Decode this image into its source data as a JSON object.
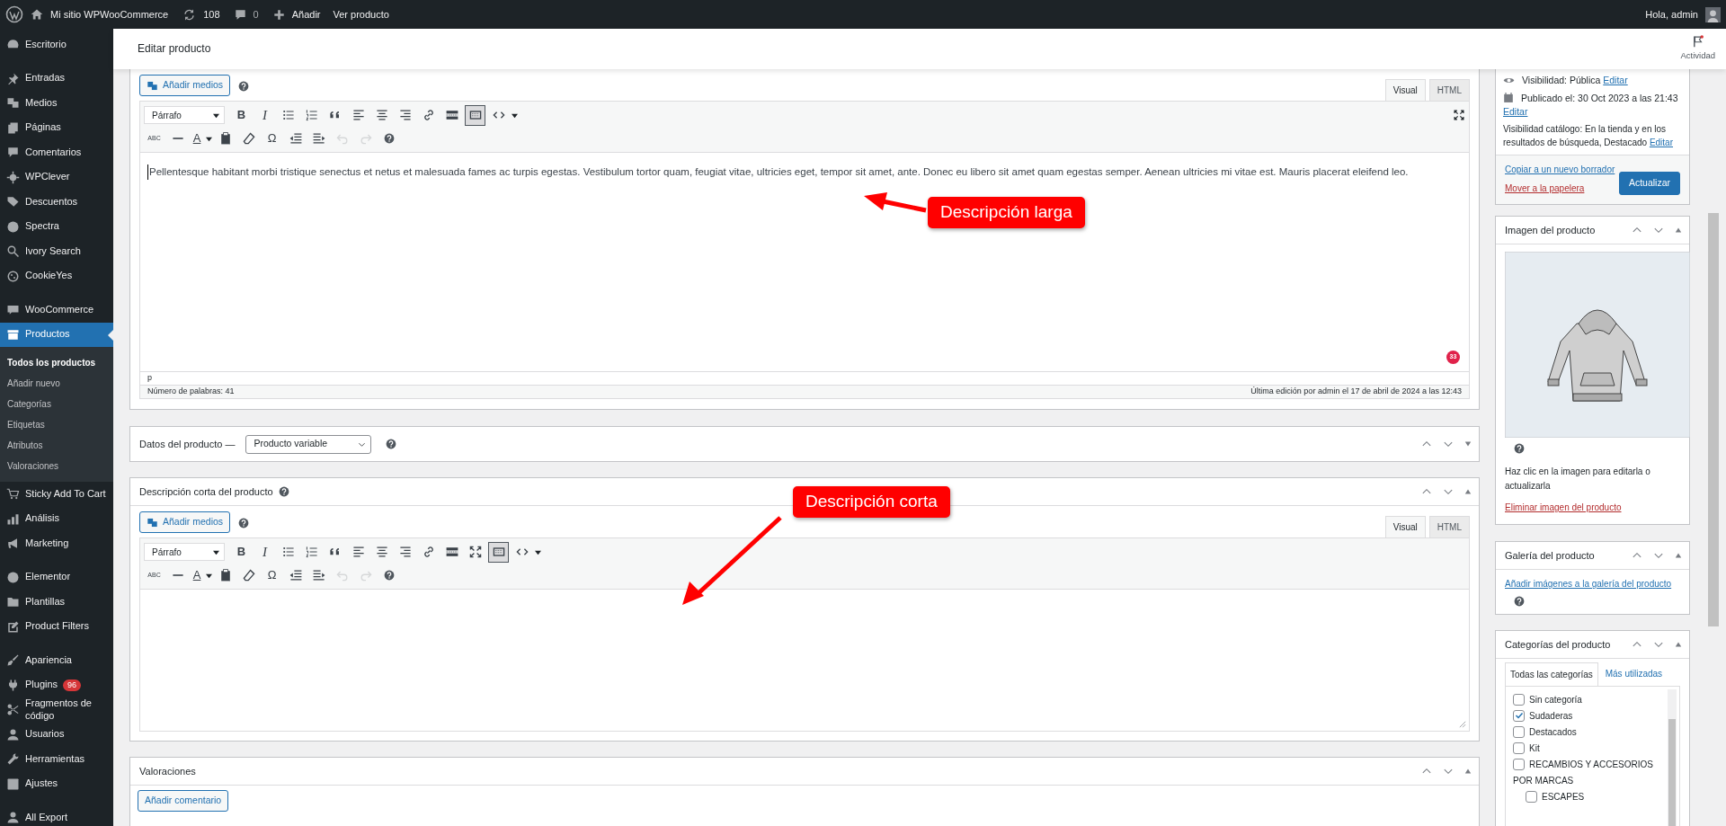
{
  "admin_bar": {
    "site": "Mi sitio WPWooCommerce",
    "updates": "108",
    "comments": "0",
    "new": "Añadir",
    "view": "Ver producto",
    "greeting": "Hola, admin"
  },
  "sidebar": {
    "groups": [
      [
        {
          "label": "Escritorio",
          "selected": false
        }
      ],
      [
        {
          "label": "Entradas",
          "selected": false
        },
        {
          "label": "Medios",
          "selected": false
        },
        {
          "label": "Páginas",
          "selected": false
        },
        {
          "label": "Comentarios",
          "selected": false
        },
        {
          "label": "WPClever",
          "selected": false
        },
        {
          "label": "Descuentos",
          "selected": false
        },
        {
          "label": "Spectra",
          "selected": false
        },
        {
          "label": "Ivory Search",
          "selected": false
        },
        {
          "label": "CookieYes",
          "selected": false
        }
      ],
      [
        {
          "label": "WooCommerce",
          "selected": false
        },
        {
          "label": "Productos",
          "selected": true,
          "children": [
            {
              "label": "Todos los productos",
              "selected": true
            },
            {
              "label": "Añadir nuevo",
              "selected": false
            },
            {
              "label": "Categorías",
              "selected": false
            },
            {
              "label": "Etiquetas",
              "selected": false
            },
            {
              "label": "Atributos",
              "selected": false
            },
            {
              "label": "Valoraciones",
              "selected": false
            }
          ]
        },
        {
          "label": "Sticky Add To Cart",
          "selected": false
        },
        {
          "label": "Análisis",
          "selected": false
        },
        {
          "label": "Marketing",
          "selected": false
        }
      ],
      [
        {
          "label": "Elementor",
          "selected": false
        },
        {
          "label": "Plantillas",
          "selected": false
        },
        {
          "label": "Product Filters",
          "selected": false
        }
      ],
      [
        {
          "label": "Apariencia",
          "selected": false
        },
        {
          "label": "Plugins",
          "selected": false,
          "badge": "96"
        },
        {
          "label": "Fragmentos de código",
          "selected": false
        },
        {
          "label": "Usuarios",
          "selected": false
        },
        {
          "label": "Herramientas",
          "selected": false
        },
        {
          "label": "Ajustes",
          "selected": false
        }
      ],
      [
        {
          "label": "All Export",
          "selected": false
        }
      ]
    ]
  },
  "header": {
    "title": "Editar producto",
    "activity": "Actividad"
  },
  "long_description": {
    "add_media": "Añadir medios",
    "tabs": [
      {
        "label": "Visual",
        "selected": true
      },
      {
        "label": "HTML",
        "selected": false
      }
    ],
    "toolbar": [
      [
        {
          "kind": "format",
          "value": "Párrafo",
          "pressed": false,
          "disabled": false
        },
        {
          "kind": "bold",
          "glyph": "B",
          "pressed": false,
          "disabled": false
        },
        {
          "kind": "italic",
          "glyph": "I",
          "pressed": false,
          "disabled": false
        },
        {
          "kind": "bullet_list",
          "pressed": false,
          "disabled": false
        },
        {
          "kind": "numbered_list",
          "pressed": false,
          "disabled": false
        },
        {
          "kind": "blockquote",
          "pressed": false,
          "disabled": false
        },
        {
          "kind": "align_left",
          "pressed": false,
          "disabled": false
        },
        {
          "kind": "align_center",
          "pressed": false,
          "disabled": false
        },
        {
          "kind": "align_right",
          "pressed": false,
          "disabled": false
        },
        {
          "kind": "link",
          "pressed": false,
          "disabled": false
        },
        {
          "kind": "read_more",
          "pressed": false,
          "disabled": false
        },
        {
          "kind": "toolbar_toggle",
          "pressed": true,
          "disabled": false
        },
        {
          "kind": "code",
          "dropdown": true,
          "pressed": false,
          "disabled": false
        }
      ],
      [
        {
          "kind": "spellcheck",
          "glyph": "ABC",
          "pressed": false,
          "disabled": false
        },
        {
          "kind": "hr",
          "pressed": false,
          "disabled": false
        },
        {
          "kind": "text_color",
          "glyph": "A",
          "dropdown": true,
          "pressed": false,
          "disabled": false
        },
        {
          "kind": "paste_text",
          "pressed": false,
          "disabled": false
        },
        {
          "kind": "clear",
          "pressed": false,
          "disabled": false
        },
        {
          "kind": "special_char",
          "glyph": "Ω",
          "pressed": false,
          "disabled": false
        },
        {
          "kind": "outdent",
          "pressed": false,
          "disabled": false
        },
        {
          "kind": "indent",
          "pressed": false,
          "disabled": false
        },
        {
          "kind": "undo",
          "pressed": false,
          "disabled": true
        },
        {
          "kind": "redo",
          "pressed": false,
          "disabled": true
        },
        {
          "kind": "help",
          "pressed": false,
          "disabled": false
        }
      ]
    ],
    "fullscreen": true,
    "text": "Pellentesque habitant morbi tristique senectus et netus et malesuada fames ac turpis egestas. Vestibulum tortor quam, feugiat vitae, ultricies eget, tempor sit amet, ante. Donec eu libero sit amet quam egestas semper. Aenean ultricies mi vitae est. Mauris placerat eleifend leo.",
    "notice_count": "33",
    "path": "p",
    "word_count": "Número de palabras: 41",
    "last_edit": "Última edición por admin el 17 de abril de 2024 a las 12:43"
  },
  "product_data": {
    "title": "Datos del producto —",
    "type": "Producto variable",
    "expanded": false
  },
  "short_description": {
    "title": "Descripción corta del producto",
    "expanded": true,
    "add_media": "Añadir medios",
    "tabs": [
      {
        "label": "Visual",
        "selected": true
      },
      {
        "label": "HTML",
        "selected": false
      }
    ],
    "toolbar": [
      [
        {
          "kind": "format",
          "value": "Párrafo",
          "pressed": false,
          "disabled": false
        },
        {
          "kind": "bold",
          "glyph": "B",
          "pressed": false,
          "disabled": false
        },
        {
          "kind": "italic",
          "glyph": "I",
          "pressed": false,
          "disabled": false
        },
        {
          "kind": "bullet_list",
          "pressed": false,
          "disabled": false
        },
        {
          "kind": "numbered_list",
          "pressed": false,
          "disabled": false
        },
        {
          "kind": "blockquote",
          "pressed": false,
          "disabled": false
        },
        {
          "kind": "align_left",
          "pressed": false,
          "disabled": false
        },
        {
          "kind": "align_center",
          "pressed": false,
          "disabled": false
        },
        {
          "kind": "align_right",
          "pressed": false,
          "disabled": false
        },
        {
          "kind": "link",
          "pressed": false,
          "disabled": false
        },
        {
          "kind": "read_more",
          "pressed": false,
          "disabled": false
        },
        {
          "kind": "fullscreen",
          "pressed": false,
          "disabled": false
        },
        {
          "kind": "toolbar_toggle",
          "pressed": true,
          "disabled": false
        },
        {
          "kind": "code",
          "dropdown": true,
          "pressed": false,
          "disabled": false
        }
      ],
      [
        {
          "kind": "spellcheck",
          "glyph": "ABC",
          "pressed": false,
          "disabled": false
        },
        {
          "kind": "hr",
          "pressed": false,
          "disabled": false
        },
        {
          "kind": "text_color",
          "glyph": "A",
          "dropdown": true,
          "pressed": false,
          "disabled": false
        },
        {
          "kind": "paste_text",
          "pressed": false,
          "disabled": false
        },
        {
          "kind": "clear",
          "pressed": false,
          "disabled": false
        },
        {
          "kind": "special_char",
          "glyph": "Ω",
          "pressed": false,
          "disabled": false
        },
        {
          "kind": "outdent",
          "pressed": false,
          "disabled": false
        },
        {
          "kind": "indent",
          "pressed": false,
          "disabled": false
        },
        {
          "kind": "undo",
          "pressed": false,
          "disabled": true
        },
        {
          "kind": "redo",
          "pressed": false,
          "disabled": true
        },
        {
          "kind": "help",
          "pressed": false,
          "disabled": false
        }
      ]
    ]
  },
  "reviews": {
    "title": "Valoraciones",
    "expanded": true,
    "button": "Añadir comentario"
  },
  "annotations": [
    {
      "label": "Descripción larga"
    },
    {
      "label": "Descripción corta"
    }
  ],
  "publish": {
    "visibility": "Visibilidad: ",
    "visibility_value": "Pública",
    "published": "Publicado el: ",
    "published_value": "30 Oct 2023 a las 21:43",
    "catalog": "Visibilidad catálogo: En la tienda y en los resultados de búsqueda, Destacado",
    "edit_visibility": "Editar",
    "edit_date": "Editar",
    "edit_catalog": "Editar",
    "copy": "Copiar a un nuevo borrador",
    "trash": "Mover a la papelera",
    "update": "Actualizar"
  },
  "product_image": {
    "title": "Imagen del producto",
    "expanded": true,
    "hint": "Haz clic en la imagen para editarla o actualizarla",
    "remove": "Eliminar imagen del producto"
  },
  "gallery": {
    "title": "Galería del producto",
    "expanded": true,
    "add": "Añadir imágenes a la galería del producto"
  },
  "categories": {
    "title": "Categorías del producto",
    "expanded": true,
    "tabs": [
      {
        "label": "Todas las categorías",
        "selected": true
      },
      {
        "label": "Más utilizadas",
        "selected": false
      }
    ],
    "items": [
      {
        "kind": "checkbox",
        "label": "Sin categoría",
        "checked": false
      },
      {
        "kind": "checkbox",
        "label": "Sudaderas",
        "checked": true
      },
      {
        "kind": "checkbox",
        "label": "Destacados",
        "checked": false
      },
      {
        "kind": "checkbox",
        "label": "Kit",
        "checked": false
      },
      {
        "kind": "checkbox",
        "label": "RECAMBIOS Y ACCESORIOS",
        "checked": false
      },
      {
        "kind": "heading",
        "label": "POR MARCAS",
        "children": [
          {
            "kind": "checkbox",
            "label": "ESCAPES",
            "checked": false
          }
        ]
      }
    ]
  }
}
